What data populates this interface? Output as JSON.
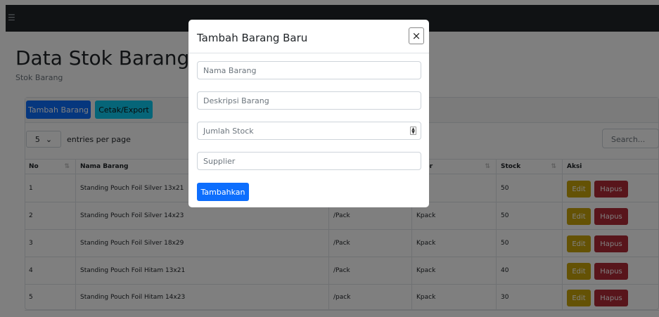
{
  "nav": {
    "menu_icon": "☰"
  },
  "page": {
    "title": "Data Stok Barang",
    "subtitle": "Stok Barang"
  },
  "toolbar": {
    "add_label": "Tambah Barang",
    "export_label": "Cetak/Export"
  },
  "table_controls": {
    "per_page_value": "5",
    "per_page_label": "entries per page",
    "search_placeholder": "Search..."
  },
  "table": {
    "headers": [
      "No",
      "Nama Barang",
      "",
      "plier",
      "Stock",
      "Aksi"
    ],
    "rows": [
      {
        "no": "1",
        "nama": "Standing Pouch Foil Silver 13x21",
        "satuan": "",
        "supplier": "ck",
        "stock": "50"
      },
      {
        "no": "2",
        "nama": "Standing Pouch Foil Silver 14x23",
        "satuan": "/Pack",
        "supplier": "Kpack",
        "stock": "50"
      },
      {
        "no": "3",
        "nama": "Standing Pouch Foil Silver 18x29",
        "satuan": "/Pack",
        "supplier": "Kpack",
        "stock": "50"
      },
      {
        "no": "4",
        "nama": "Standing Pouch Foil Hitam 13x21",
        "satuan": "/Pack",
        "supplier": "Kpack",
        "stock": "40"
      },
      {
        "no": "5",
        "nama": "Standing Pouch Foil Hitam 14x23",
        "satuan": "/pack",
        "supplier": "Kpack",
        "stock": "30"
      }
    ],
    "edit_label": "Edit",
    "delete_label": "Hapus"
  },
  "modal": {
    "title": "Tambah Barang Baru",
    "close_icon": "×",
    "fields": {
      "nama": "Nama Barang",
      "deskripsi": "Deskripsi Barang",
      "jumlah": "Jumlah Stock",
      "supplier": "Supplier"
    },
    "submit_label": "Tambahkan"
  },
  "colors": {
    "primary": "#0d6efd",
    "info": "#0dcaf0",
    "warning": "#c9a40b",
    "danger": "#b02a37",
    "navbar": "#212529"
  }
}
